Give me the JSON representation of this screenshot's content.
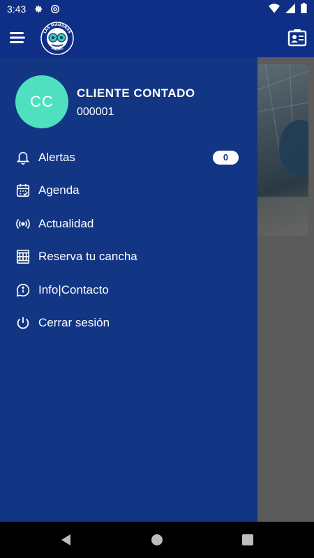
{
  "status_bar": {
    "time": "3:43",
    "left_icons": [
      "settings-gear-icon",
      "at-sign-icon"
    ],
    "right_icons": [
      "wifi-icon",
      "cellular-signal-icon",
      "battery-icon"
    ]
  },
  "app_bar": {
    "menu_icon": "hamburger-menu-icon",
    "logo_text_top": "LAS MAÑANAS",
    "logo_text_bottom": "PADEL",
    "right_icon": "contact-card-icon"
  },
  "drawer": {
    "avatar_initials": "CC",
    "user_name": "CLIENTE CONTADO",
    "user_id": "000001",
    "items": [
      {
        "label": "Alertas",
        "icon": "bell-icon",
        "badge": "0"
      },
      {
        "label": "Agenda",
        "icon": "calendar-check-icon"
      },
      {
        "label": "Actualidad",
        "icon": "broadcast-icon"
      },
      {
        "label": "Reserva tu cancha",
        "icon": "court-icon"
      },
      {
        "label": "Info|Contacto",
        "icon": "info-chat-icon"
      },
      {
        "label": "Cerrar sesión",
        "icon": "power-icon"
      }
    ]
  },
  "colors": {
    "primary": "#0f2e86",
    "drawer": "#123584",
    "avatar": "#4fe0c0"
  }
}
